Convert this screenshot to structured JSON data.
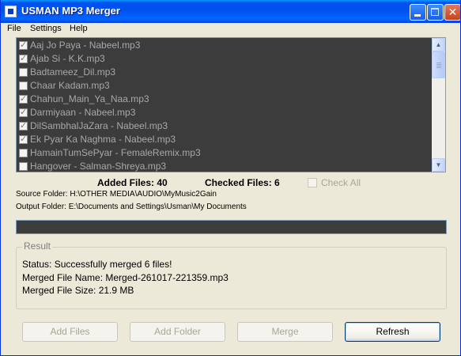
{
  "window": {
    "title": "USMAN MP3 Merger"
  },
  "menu": [
    {
      "label": "File"
    },
    {
      "label": "Settings"
    },
    {
      "label": "Help"
    }
  ],
  "files": [
    {
      "name": "Aaj Jo Paya - Nabeel.mp3",
      "checked": true
    },
    {
      "name": "Ajab Si - K.K.mp3",
      "checked": true
    },
    {
      "name": "Badtameez_Dil.mp3",
      "checked": false
    },
    {
      "name": "Chaar Kadam.mp3",
      "checked": false
    },
    {
      "name": "Chahun_Main_Ya_Naa.mp3",
      "checked": true
    },
    {
      "name": "Darmiyaan - Nabeel.mp3",
      "checked": true
    },
    {
      "name": "DilSambhalJaZara - Nabeel.mp3",
      "checked": true
    },
    {
      "name": "Ek Pyar Ka Naghma - Nabeel.mp3",
      "checked": true
    },
    {
      "name": "HamainTumSePyar - FemaleRemix.mp3",
      "checked": false
    },
    {
      "name": "Hangover - Salman-Shreya.mp3",
      "checked": false
    }
  ],
  "stats": {
    "added_label": "Added Files: 40",
    "checked_label": "Checked Files: 6",
    "check_all_label": "Check All"
  },
  "folders": {
    "source": "Source Folder: H:\\OTHER MEDIA\\AUDIO\\MyMusic2Gain",
    "output": "Output Folder: E:\\Documents and Settings\\Usman\\My Documents"
  },
  "progress": 0,
  "result": {
    "legend": "Result",
    "status": "Status: Successfully merged 6 files!",
    "file_name": "Merged File Name: Merged-261017-221359.mp3",
    "file_size": "Merged File Size: 21.9 MB"
  },
  "buttons": {
    "add_files": "Add Files",
    "add_folder": "Add Folder",
    "merge": "Merge",
    "refresh": "Refresh"
  },
  "colors": {
    "titlebar": "#0053ee",
    "list_background": "#3c3c3c",
    "disabled_text": "#a9a793"
  },
  "icons": {
    "app": "app-icon",
    "minimize": "minimize-icon",
    "maximize": "maximize-icon",
    "close": "close-icon",
    "scroll_up": "scroll-up-arrow-icon",
    "scroll_down": "scroll-down-arrow-icon"
  }
}
